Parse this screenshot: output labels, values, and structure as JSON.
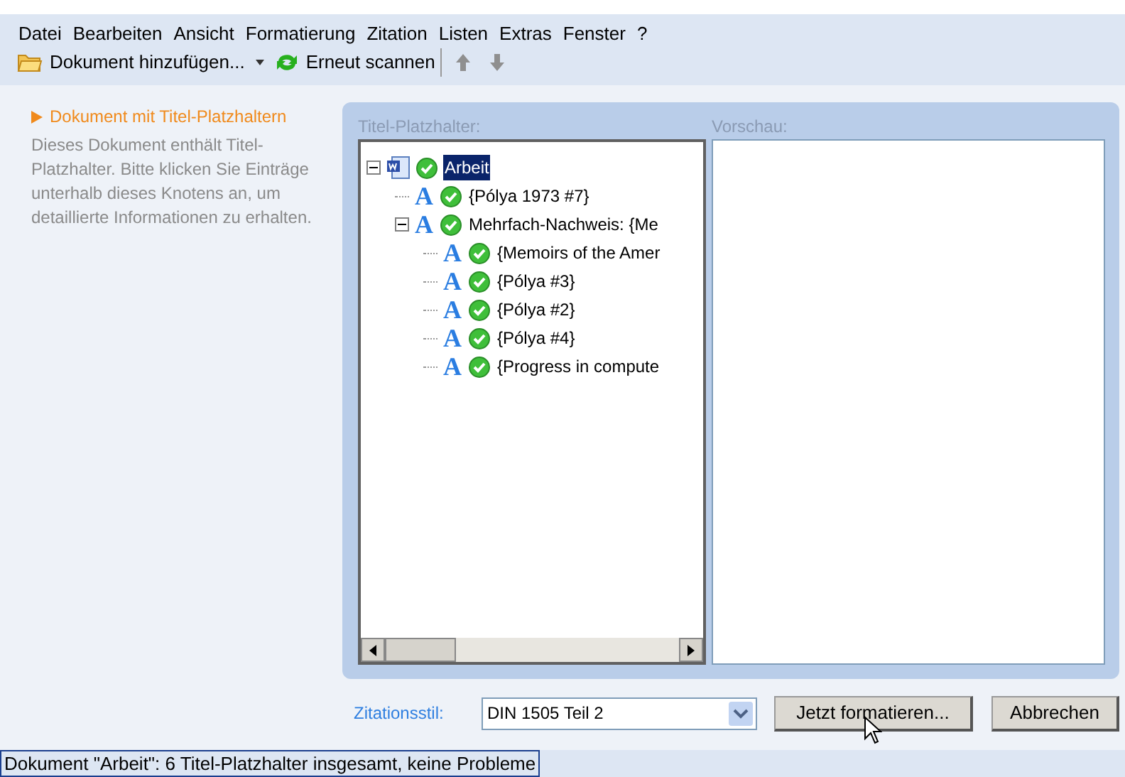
{
  "menu": [
    "Datei",
    "Bearbeiten",
    "Ansicht",
    "Formatierung",
    "Zitation",
    "Listen",
    "Extras",
    "Fenster",
    "?"
  ],
  "toolbar": {
    "add_document": "Dokument hinzufügen...",
    "rescan": "Erneut scannen"
  },
  "sidebar": {
    "heading": "Dokument mit Titel-Platzhaltern",
    "description": "Dieses Dokument enthält Titel-Platzhalter. Bitte klicken Sie Einträge unterhalb dieses Knotens an, um detaillierte Informationen zu erhalten."
  },
  "placeholders": {
    "label": "Titel-Platzhalter:",
    "tree": [
      {
        "kind": "document",
        "label": "Arbeit",
        "selected": true,
        "expanded": true,
        "children": [
          {
            "kind": "citation",
            "icon": "A",
            "label": "{Pólya 1973 #7}",
            "selected": false
          },
          {
            "kind": "citation",
            "icon": "A",
            "label": "Mehrfach-Nachweis: {Me",
            "selected": false,
            "expanded": true,
            "children": [
              {
                "kind": "citation",
                "icon": "A",
                "label": "{Memoirs of the Amer",
                "selected": false
              },
              {
                "kind": "citation",
                "icon": "A",
                "label": "{Pólya #3}",
                "selected": false
              },
              {
                "kind": "citation",
                "icon": "A",
                "label": "{Pólya #2}",
                "selected": false
              },
              {
                "kind": "citation",
                "icon": "A",
                "label": "{Pólya #4}",
                "selected": false
              },
              {
                "kind": "citation",
                "icon": "A",
                "label": "{Progress in compute",
                "selected": false
              }
            ]
          }
        ]
      }
    ]
  },
  "preview": {
    "label": "Vorschau:"
  },
  "style": {
    "label": "Zitationsstil:",
    "value": "DIN 1505 Teil 2"
  },
  "buttons": [
    "Jetzt formatieren...",
    "Abbrechen"
  ],
  "status_bar": "Dokument \"Arbeit\": 6 Titel-Platzhalter insgesamt, keine Probleme"
}
